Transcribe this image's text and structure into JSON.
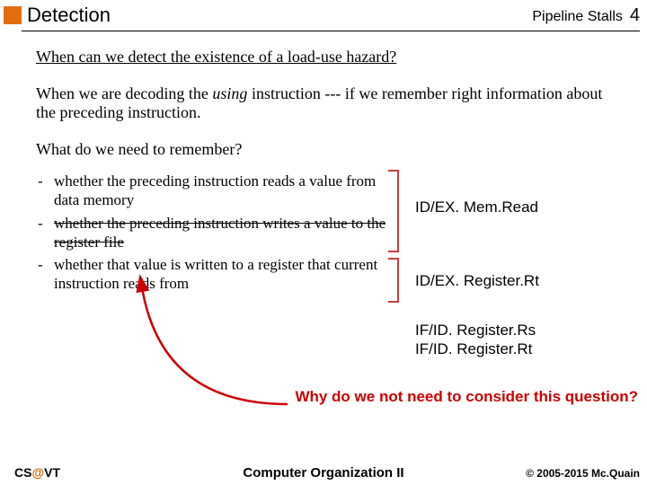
{
  "header": {
    "title": "Detection",
    "section": "Pipeline Stalls",
    "page": "4"
  },
  "body": {
    "q1": "When can we detect the existence of a load-use hazard?",
    "p2a": "When we are decoding the ",
    "p2em": "using",
    "p2b": " instruction --- if we remember right information about the preceding instruction.",
    "p3": "What do we need to remember?",
    "li1": "whether the preceding instruction reads a value from data memory",
    "li2": "whether the preceding instruction writes a value to the register file",
    "li3": "whether that value is written to a register that current instruction reads from",
    "label1": "ID/EX. Mem.Read",
    "label2": "ID/EX. Register.Rt",
    "label3a": "IF/ID. Register.Rs",
    "label3b": "IF/ID. Register.Rt",
    "q2": "Why do we not need to consider this question?"
  },
  "footer": {
    "left_a": "CS",
    "left_at": "@",
    "left_b": "VT",
    "center": "Computer Organization II",
    "right": "© 2005-2015 Mc.Quain"
  }
}
